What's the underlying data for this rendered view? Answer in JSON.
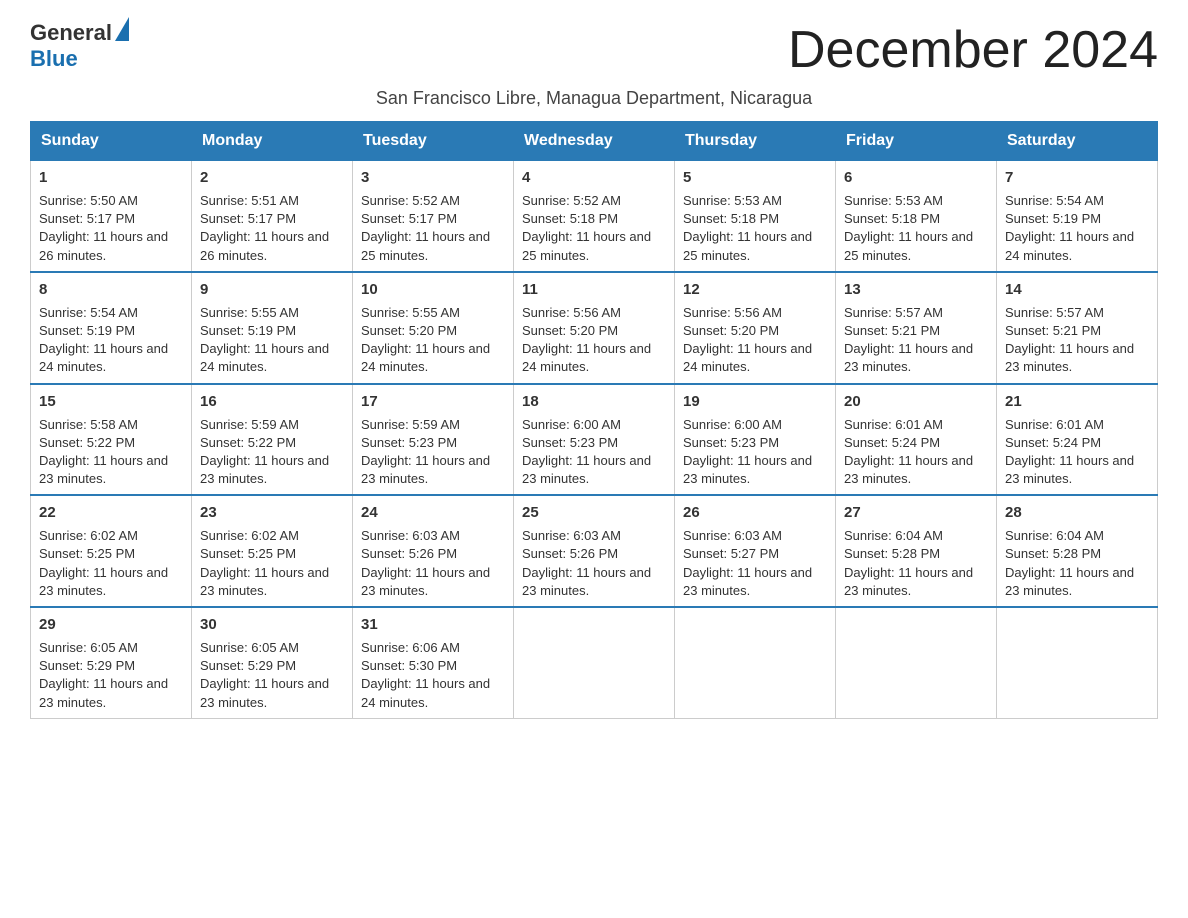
{
  "header": {
    "logo_general": "General",
    "logo_blue": "Blue",
    "month_title": "December 2024",
    "subtitle": "San Francisco Libre, Managua Department, Nicaragua"
  },
  "weekdays": [
    "Sunday",
    "Monday",
    "Tuesday",
    "Wednesday",
    "Thursday",
    "Friday",
    "Saturday"
  ],
  "weeks": [
    [
      {
        "day": "1",
        "sunrise": "Sunrise: 5:50 AM",
        "sunset": "Sunset: 5:17 PM",
        "daylight": "Daylight: 11 hours and 26 minutes."
      },
      {
        "day": "2",
        "sunrise": "Sunrise: 5:51 AM",
        "sunset": "Sunset: 5:17 PM",
        "daylight": "Daylight: 11 hours and 26 minutes."
      },
      {
        "day": "3",
        "sunrise": "Sunrise: 5:52 AM",
        "sunset": "Sunset: 5:17 PM",
        "daylight": "Daylight: 11 hours and 25 minutes."
      },
      {
        "day": "4",
        "sunrise": "Sunrise: 5:52 AM",
        "sunset": "Sunset: 5:18 PM",
        "daylight": "Daylight: 11 hours and 25 minutes."
      },
      {
        "day": "5",
        "sunrise": "Sunrise: 5:53 AM",
        "sunset": "Sunset: 5:18 PM",
        "daylight": "Daylight: 11 hours and 25 minutes."
      },
      {
        "day": "6",
        "sunrise": "Sunrise: 5:53 AM",
        "sunset": "Sunset: 5:18 PM",
        "daylight": "Daylight: 11 hours and 25 minutes."
      },
      {
        "day": "7",
        "sunrise": "Sunrise: 5:54 AM",
        "sunset": "Sunset: 5:19 PM",
        "daylight": "Daylight: 11 hours and 24 minutes."
      }
    ],
    [
      {
        "day": "8",
        "sunrise": "Sunrise: 5:54 AM",
        "sunset": "Sunset: 5:19 PM",
        "daylight": "Daylight: 11 hours and 24 minutes."
      },
      {
        "day": "9",
        "sunrise": "Sunrise: 5:55 AM",
        "sunset": "Sunset: 5:19 PM",
        "daylight": "Daylight: 11 hours and 24 minutes."
      },
      {
        "day": "10",
        "sunrise": "Sunrise: 5:55 AM",
        "sunset": "Sunset: 5:20 PM",
        "daylight": "Daylight: 11 hours and 24 minutes."
      },
      {
        "day": "11",
        "sunrise": "Sunrise: 5:56 AM",
        "sunset": "Sunset: 5:20 PM",
        "daylight": "Daylight: 11 hours and 24 minutes."
      },
      {
        "day": "12",
        "sunrise": "Sunrise: 5:56 AM",
        "sunset": "Sunset: 5:20 PM",
        "daylight": "Daylight: 11 hours and 24 minutes."
      },
      {
        "day": "13",
        "sunrise": "Sunrise: 5:57 AM",
        "sunset": "Sunset: 5:21 PM",
        "daylight": "Daylight: 11 hours and 23 minutes."
      },
      {
        "day": "14",
        "sunrise": "Sunrise: 5:57 AM",
        "sunset": "Sunset: 5:21 PM",
        "daylight": "Daylight: 11 hours and 23 minutes."
      }
    ],
    [
      {
        "day": "15",
        "sunrise": "Sunrise: 5:58 AM",
        "sunset": "Sunset: 5:22 PM",
        "daylight": "Daylight: 11 hours and 23 minutes."
      },
      {
        "day": "16",
        "sunrise": "Sunrise: 5:59 AM",
        "sunset": "Sunset: 5:22 PM",
        "daylight": "Daylight: 11 hours and 23 minutes."
      },
      {
        "day": "17",
        "sunrise": "Sunrise: 5:59 AM",
        "sunset": "Sunset: 5:23 PM",
        "daylight": "Daylight: 11 hours and 23 minutes."
      },
      {
        "day": "18",
        "sunrise": "Sunrise: 6:00 AM",
        "sunset": "Sunset: 5:23 PM",
        "daylight": "Daylight: 11 hours and 23 minutes."
      },
      {
        "day": "19",
        "sunrise": "Sunrise: 6:00 AM",
        "sunset": "Sunset: 5:23 PM",
        "daylight": "Daylight: 11 hours and 23 minutes."
      },
      {
        "day": "20",
        "sunrise": "Sunrise: 6:01 AM",
        "sunset": "Sunset: 5:24 PM",
        "daylight": "Daylight: 11 hours and 23 minutes."
      },
      {
        "day": "21",
        "sunrise": "Sunrise: 6:01 AM",
        "sunset": "Sunset: 5:24 PM",
        "daylight": "Daylight: 11 hours and 23 minutes."
      }
    ],
    [
      {
        "day": "22",
        "sunrise": "Sunrise: 6:02 AM",
        "sunset": "Sunset: 5:25 PM",
        "daylight": "Daylight: 11 hours and 23 minutes."
      },
      {
        "day": "23",
        "sunrise": "Sunrise: 6:02 AM",
        "sunset": "Sunset: 5:25 PM",
        "daylight": "Daylight: 11 hours and 23 minutes."
      },
      {
        "day": "24",
        "sunrise": "Sunrise: 6:03 AM",
        "sunset": "Sunset: 5:26 PM",
        "daylight": "Daylight: 11 hours and 23 minutes."
      },
      {
        "day": "25",
        "sunrise": "Sunrise: 6:03 AM",
        "sunset": "Sunset: 5:26 PM",
        "daylight": "Daylight: 11 hours and 23 minutes."
      },
      {
        "day": "26",
        "sunrise": "Sunrise: 6:03 AM",
        "sunset": "Sunset: 5:27 PM",
        "daylight": "Daylight: 11 hours and 23 minutes."
      },
      {
        "day": "27",
        "sunrise": "Sunrise: 6:04 AM",
        "sunset": "Sunset: 5:28 PM",
        "daylight": "Daylight: 11 hours and 23 minutes."
      },
      {
        "day": "28",
        "sunrise": "Sunrise: 6:04 AM",
        "sunset": "Sunset: 5:28 PM",
        "daylight": "Daylight: 11 hours and 23 minutes."
      }
    ],
    [
      {
        "day": "29",
        "sunrise": "Sunrise: 6:05 AM",
        "sunset": "Sunset: 5:29 PM",
        "daylight": "Daylight: 11 hours and 23 minutes."
      },
      {
        "day": "30",
        "sunrise": "Sunrise: 6:05 AM",
        "sunset": "Sunset: 5:29 PM",
        "daylight": "Daylight: 11 hours and 23 minutes."
      },
      {
        "day": "31",
        "sunrise": "Sunrise: 6:06 AM",
        "sunset": "Sunset: 5:30 PM",
        "daylight": "Daylight: 11 hours and 24 minutes."
      },
      null,
      null,
      null,
      null
    ]
  ]
}
